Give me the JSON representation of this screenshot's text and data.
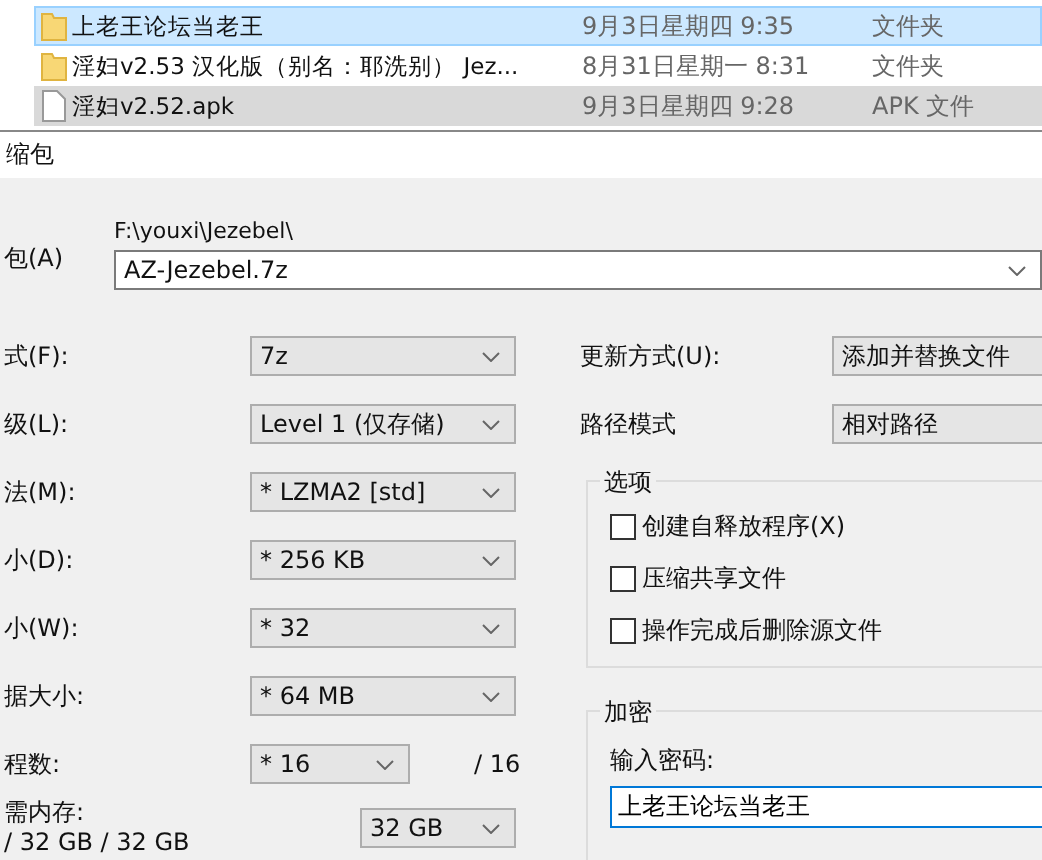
{
  "files": [
    {
      "name": "上老王论坛当老王",
      "date": "9月3日星期四 9:35",
      "type": "文件夹",
      "kind": "folder",
      "selected": true,
      "hovered": false
    },
    {
      "name": "淫妇v2.53 汉化版（别名：耶洗别） Jez...",
      "date": "8月31日星期一 8:31",
      "type": "文件夹",
      "kind": "folder",
      "selected": false,
      "hovered": false
    },
    {
      "name": "淫妇v2.52.apk",
      "date": "9月3日星期四 9:28",
      "type": "APK 文件",
      "kind": "file",
      "selected": false,
      "hovered": true
    }
  ],
  "dialog": {
    "title": "缩包",
    "archive": {
      "label": "包(A)",
      "path": "F:\\youxi\\Jezebel\\",
      "value": "AZ-Jezebel.7z"
    },
    "left_options": [
      {
        "label": "式(F):",
        "value": "7z",
        "kind": "full"
      },
      {
        "label": "级(L):",
        "value": "Level 1 (仅存储)",
        "kind": "full"
      },
      {
        "label": "法(M):",
        "value": "* LZMA2 [std]",
        "kind": "full"
      },
      {
        "label": "小(D):",
        "value": "* 256 KB",
        "kind": "full"
      },
      {
        "label": "小(W):",
        "value": "* 32",
        "kind": "full"
      },
      {
        "label": "据大小:",
        "value": "* 64 MB",
        "kind": "full"
      },
      {
        "label": "程数:",
        "value": "* 16",
        "kind": "short",
        "suffix": "/ 16"
      }
    ],
    "memory": {
      "label": "需内存:",
      "usage": "/ 32 GB / 32 GB",
      "value": "32 GB"
    },
    "right_options": [
      {
        "label": "更新方式(U):",
        "value": "添加并替换文件"
      },
      {
        "label": "路径模式",
        "value": "相对路径"
      }
    ],
    "options_group": {
      "title": "选项",
      "items": [
        {
          "label": "创建自释放程序(X)",
          "checked": false
        },
        {
          "label": "压缩共享文件",
          "checked": false
        },
        {
          "label": "操作完成后删除源文件",
          "checked": false
        }
      ]
    },
    "encryption": {
      "title": "加密",
      "password_label": "输入密码:",
      "password": "上老王论坛当老王"
    }
  }
}
